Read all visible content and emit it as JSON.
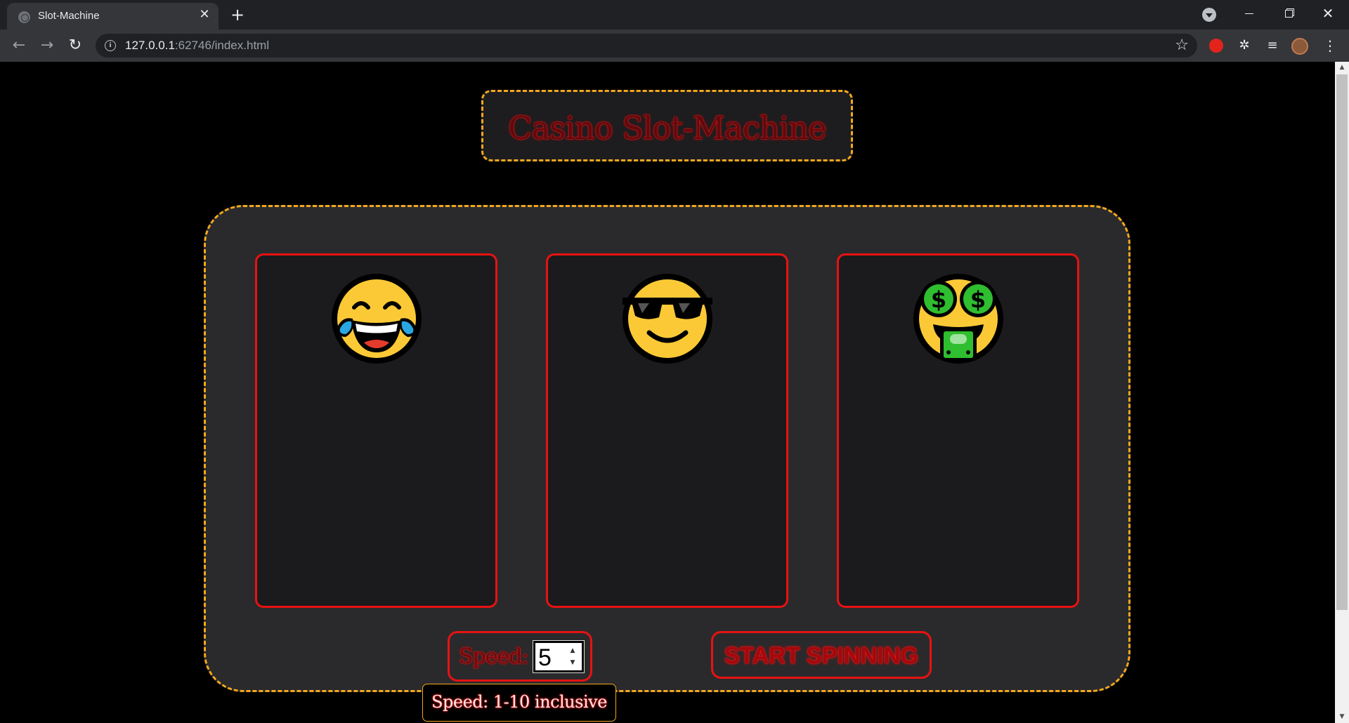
{
  "browser": {
    "tab_title": "Slot-Machine",
    "tab_close": "✕",
    "new_tab": "+",
    "url_host": "127.0.0.1",
    "url_rest": ":62746/index.html"
  },
  "page": {
    "title": "Casino Slot-Machine",
    "reels": [
      {
        "symbol": "face-with-tears-of-joy-icon"
      },
      {
        "symbol": "smiling-face-with-sunglasses-icon"
      },
      {
        "symbol": "money-mouth-face-icon"
      }
    ],
    "speed": {
      "label": "Speed:",
      "value": "5",
      "tooltip": "Speed: 1-10 inclusive"
    },
    "start_button_label": "START SPINNING"
  },
  "colors": {
    "frame_dashed": "#f4a81d",
    "reel_border": "#e81212",
    "machine_bg": "#2a2a2c",
    "page_bg": "#000000"
  }
}
